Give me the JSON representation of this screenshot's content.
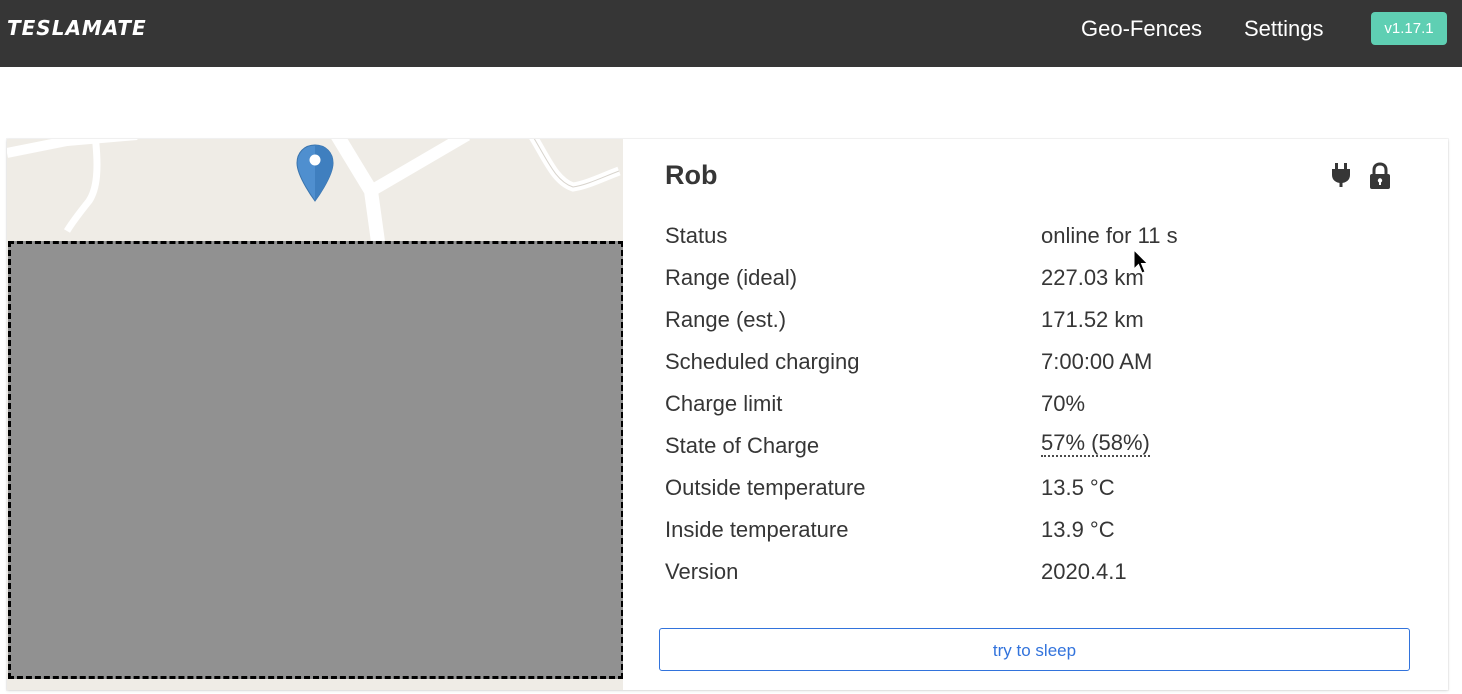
{
  "navbar": {
    "brand": "TESLAMATE",
    "links": [
      {
        "label": "Geo-Fences"
      },
      {
        "label": "Settings"
      }
    ],
    "version": "v1.17.1"
  },
  "car": {
    "name": "Rob",
    "status_icons": [
      "plug-icon",
      "lock-icon"
    ],
    "rows": [
      {
        "label": "Status",
        "value": "online for 11 s"
      },
      {
        "label": "Range (ideal)",
        "value": "227.03 km"
      },
      {
        "label": "Range (est.)",
        "value": "171.52 km"
      },
      {
        "label": "Scheduled charging",
        "value": "7:00:00 AM"
      },
      {
        "label": "Charge limit",
        "value": "70%"
      },
      {
        "label": "State of Charge",
        "value": "57% (58%)"
      },
      {
        "label": "Outside temperature",
        "value": "13.5 °C"
      },
      {
        "label": "Inside temperature",
        "value": "13.9 °C"
      },
      {
        "label": "Version",
        "value": "2020.4.1"
      }
    ],
    "sleep_button": "try to sleep"
  },
  "map": {
    "marker_color": "#4f8fcf",
    "icon": "map-pin-icon"
  },
  "colors": {
    "navbar": "#363636",
    "version_tag": "#5fcfb3",
    "link": "#3273dc",
    "placeholder": "#919191"
  }
}
